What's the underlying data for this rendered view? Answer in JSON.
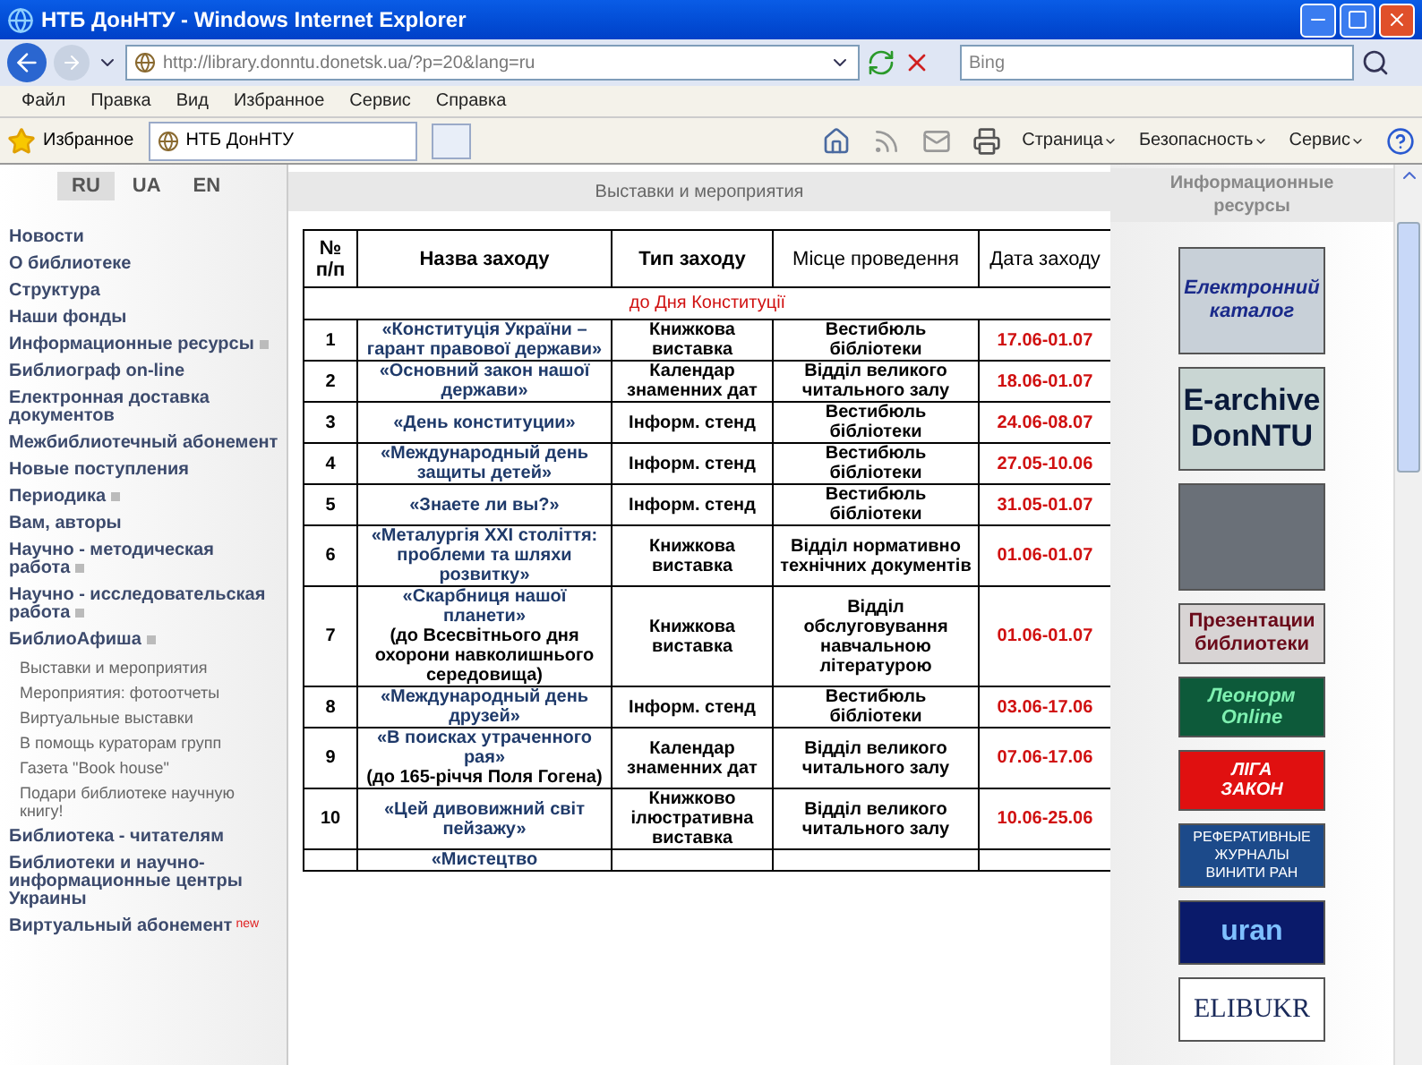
{
  "window": {
    "title": "НТБ ДонНТУ - Windows Internet Explorer"
  },
  "address_bar": {
    "url": "http://library.donntu.donetsk.ua/?p=20&lang=ru"
  },
  "search": {
    "placeholder": "Bing"
  },
  "menu": [
    "Файл",
    "Правка",
    "Вид",
    "Избранное",
    "Сервис",
    "Справка"
  ],
  "favorites_bar": {
    "favorites": "Избранное",
    "tabs": [
      {
        "label": "НТБ ДонНТУ",
        "selected": true
      }
    ],
    "commands": [
      "Страница",
      "Безопасность",
      "Сервис"
    ]
  },
  "languages": [
    {
      "label": "RU",
      "selected": true
    },
    {
      "label": "UA",
      "selected": false
    },
    {
      "label": "EN",
      "selected": false
    }
  ],
  "sidebar": {
    "items": [
      {
        "label": "Новости",
        "expandable": false
      },
      {
        "label": "О библиотеке",
        "expandable": false
      },
      {
        "label": "Структура",
        "expandable": false
      },
      {
        "label": "Наши фонды",
        "expandable": false
      },
      {
        "label": "Информационные ресурсы",
        "expandable": true
      },
      {
        "label": "Библиограф on-line",
        "expandable": false
      },
      {
        "label": "Електронная доставка документов",
        "expandable": false
      },
      {
        "label": "Межбиблиотечный абонемент",
        "expandable": false
      },
      {
        "label": "Новые поступления",
        "expandable": false
      },
      {
        "label": "Периодика",
        "expandable": true
      },
      {
        "label": "Вам, авторы",
        "expandable": false
      },
      {
        "label": "Научно - методическая работа",
        "expandable": true
      },
      {
        "label": "Научно - исследовательская работа",
        "expandable": true
      },
      {
        "label": "БиблиоАфиша",
        "expandable": true,
        "children": [
          {
            "label": "Выставки и мероприятия"
          },
          {
            "label": "Мероприятия: фотоотчеты"
          },
          {
            "label": "Виртуальные выставки"
          },
          {
            "label": "В помощь кураторам групп"
          },
          {
            "label": "Газета \"Book house\""
          },
          {
            "label": "Подари библиотеке научную книгу!"
          }
        ]
      },
      {
        "label": "Библиотека - читателям",
        "expandable": false
      },
      {
        "label": "Библиотеки и научно-информационные центры Украины",
        "expandable": false
      },
      {
        "label": "Виртуальный абонемент",
        "expandable": false,
        "badge": "new"
      }
    ]
  },
  "content": {
    "title": "Выставки и мероприятия",
    "table": {
      "columns": [
        "№ п/п",
        "Назва заходу",
        "Тип заходу",
        "Місце проведення",
        "Дата заходу"
      ],
      "section": "до Дня Конституції",
      "rows": [
        {
          "number": "1",
          "name": "«Конституція України – гарант правової держави»",
          "type": "Книжкова виставка",
          "place": "Вестибюль бібліотеки",
          "date": "17.06-01.07"
        },
        {
          "number": "2",
          "name": "«Основний закон нашої держави»",
          "type": "Календар знаменних дат",
          "place": "Відділ великого читального залу",
          "date": "18.06-01.07"
        },
        {
          "number": "3",
          "name": "«День конституции»",
          "type": "Інформ. стенд",
          "place": "Вестибюль бібліотеки",
          "date": "24.06-08.07"
        },
        {
          "number": "4",
          "name": "«Международный день защиты детей»",
          "type": "Інформ. стенд",
          "place": "Вестибюль бібліотеки",
          "date": "27.05-10.06"
        },
        {
          "number": "5",
          "name": "«Знаете ли вы?»",
          "type": "Інформ. стенд",
          "place": "Вестибюль бібліотеки",
          "date": "31.05-01.07"
        },
        {
          "number": "6",
          "name": "«Металургія XXI століття: проблеми та шляхи розвитку»",
          "type": "Книжкова виставка",
          "place": "Відділ нормативно технічних документів",
          "date": "01.06-01.07"
        },
        {
          "number": "7",
          "name": "«Скарбниця нашої планети»",
          "note": "(до Всесвітнього дня охорони навколишнього середовища)",
          "type": "Книжкова виставка",
          "place": "Відділ обслуговування навчальною літературою",
          "date": "01.06-01.07"
        },
        {
          "number": "8",
          "name": "«Международный день друзей»",
          "type": "Інформ. стенд",
          "place": "Вестибюль бібліотеки",
          "date": "03.06-17.06"
        },
        {
          "number": "9",
          "name": "«В поисках утраченного рая»",
          "note": "(до 165-річчя Поля Гогена)",
          "type": "Календар знаменних дат",
          "place": "Відділ великого читального залу",
          "date": "07.06-17.06"
        },
        {
          "number": "10",
          "name": "«Цей дивовижний світ пейзажу»",
          "type": "Книжково ілюстративна виставка",
          "place": "Відділ великого читального залу",
          "date": "10.06-25.06"
        },
        {
          "name": "«Мистецтво"
        }
      ]
    }
  },
  "resources": {
    "title": "Информационные ресурсы",
    "banners": [
      {
        "kind": "catalog",
        "lines": [
          "Електронний",
          "каталог"
        ]
      },
      {
        "kind": "archive",
        "lines": [
          "E-archive",
          "DonNTU"
        ]
      },
      {
        "kind": "photo"
      },
      {
        "kind": "presentation",
        "lines": [
          "Презентации",
          "библиотеки"
        ]
      },
      {
        "kind": "leonorm",
        "lines": [
          "Леонорм",
          "Online"
        ]
      },
      {
        "kind": "liga",
        "lines": [
          "ЛІГА",
          "ЗАКОН"
        ]
      },
      {
        "kind": "viniti",
        "lines": [
          "РЕФЕРАТИВНЫЕ",
          "ЖУРНАЛЫ",
          "ВИНИТИ РАН"
        ]
      },
      {
        "kind": "uran",
        "lines": [
          "uran"
        ]
      },
      {
        "kind": "elibukr",
        "lines": [
          "ELIBUKR"
        ]
      }
    ]
  }
}
